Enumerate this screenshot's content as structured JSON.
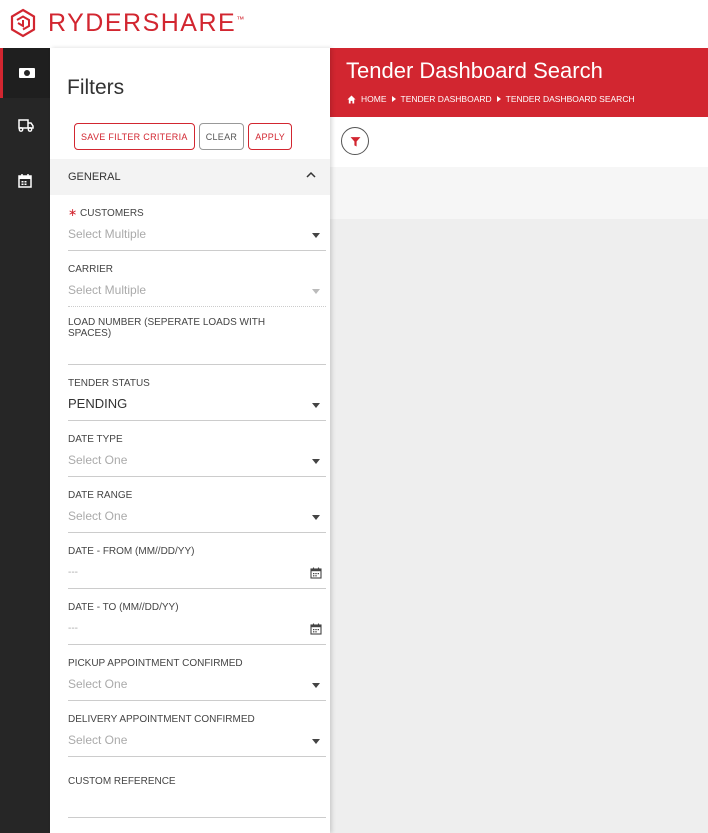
{
  "brand": {
    "name_bold": "RYDER",
    "name_light": "SHARE",
    "tm": "™"
  },
  "rail": {
    "items": [
      "dashboard-icon",
      "truck-icon",
      "calendar-icon"
    ]
  },
  "filters": {
    "title": "Filters",
    "buttons": {
      "save": "SAVE FILTER CRITERIA",
      "clear": "CLEAR",
      "apply": "APPLY"
    },
    "section": "GENERAL",
    "fields": {
      "customers": {
        "label": "CUSTOMERS",
        "required": "∗",
        "value": "Select Multiple"
      },
      "carrier": {
        "label": "CARRIER",
        "value": "Select Multiple"
      },
      "load_number": {
        "label": "LOAD NUMBER (SEPERATE LOADS WITH SPACES)",
        "value": ""
      },
      "tender_status": {
        "label": "TENDER STATUS",
        "value": "PENDING"
      },
      "date_type": {
        "label": "DATE TYPE",
        "value": "Select One"
      },
      "date_range": {
        "label": "DATE RANGE",
        "value": "Select One"
      },
      "date_from": {
        "label": "DATE - FROM (MM//DD/YY)",
        "value": "---"
      },
      "date_to": {
        "label": "DATE - TO (MM//DD/YY)",
        "value": "---"
      },
      "pickup_confirmed": {
        "label": "PICKUP APPOINTMENT CONFIRMED",
        "value": "Select One"
      },
      "delivery_confirmed": {
        "label": "DELIVERY APPOINTMENT CONFIRMED",
        "value": "Select One"
      },
      "custom_reference": {
        "label": "CUSTOM REFERENCE",
        "value": ""
      }
    }
  },
  "header": {
    "title": "Tender Dashboard Search",
    "breadcrumb": [
      "HOME",
      "TENDER DASHBOARD",
      "TENDER DASHBOARD SEARCH"
    ]
  },
  "colors": {
    "accent": "#d22630",
    "rail": "#262626",
    "background": "#eeeeee"
  }
}
